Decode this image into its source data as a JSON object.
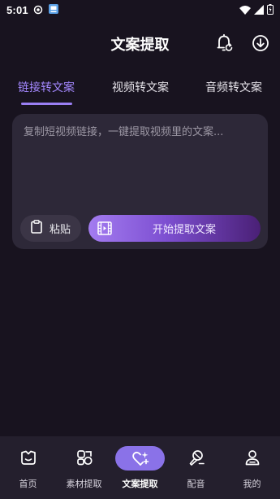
{
  "status_bar": {
    "time": "5:01"
  },
  "header": {
    "title": "文案提取",
    "actions": [
      "bell-refresh-icon",
      "download-icon"
    ]
  },
  "tabs": [
    {
      "label": "链接转文案",
      "active": true
    },
    {
      "label": "视频转文案",
      "active": false
    },
    {
      "label": "音频转文案",
      "active": false
    }
  ],
  "card": {
    "placeholder": "复制短视频链接，一键提取视频里的文案...",
    "paste_label": "粘贴",
    "start_label": "开始提取文案"
  },
  "bottom_nav": [
    {
      "label": "首页",
      "icon": "home-face-icon",
      "active": false
    },
    {
      "label": "素材提取",
      "icon": "material-icon",
      "active": false
    },
    {
      "label": "文案提取",
      "icon": "heart-sparkle-icon",
      "active": true
    },
    {
      "label": "配音",
      "icon": "dubbing-icon",
      "active": false
    },
    {
      "label": "我的",
      "icon": "profile-icon",
      "active": false
    }
  ],
  "colors": {
    "background": "#18131f",
    "card": "#2d2838",
    "accent": "#9a7ff4",
    "nav_background": "#241f2d"
  }
}
